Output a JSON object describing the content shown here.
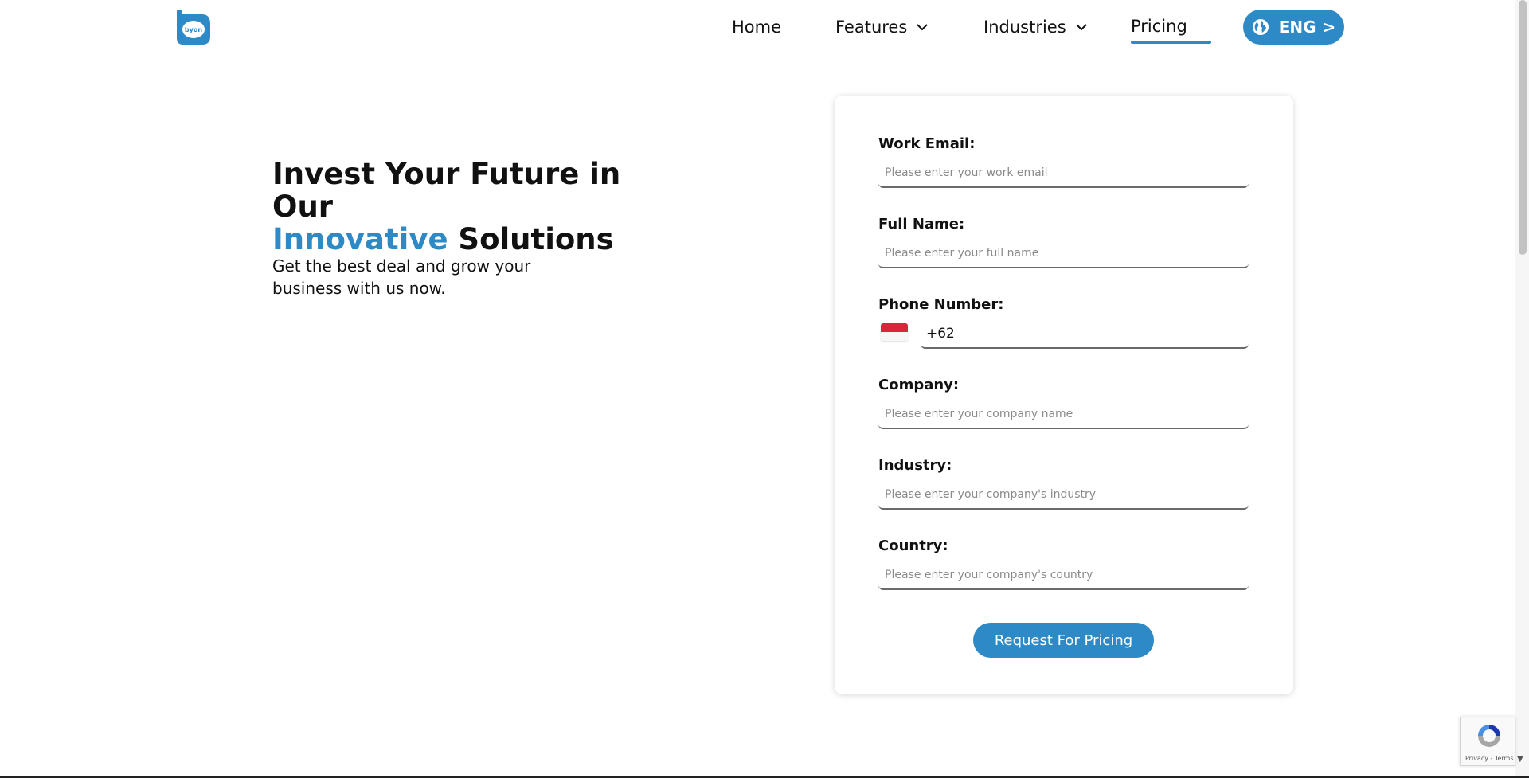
{
  "header": {
    "logo_text": "byon",
    "nav": {
      "home": "Home",
      "features": "Features",
      "industries": "Industries",
      "pricing": "Pricing"
    },
    "lang_label": "ENG",
    "lang_arrow": ">"
  },
  "hero": {
    "title_line1": "Invest Your Future in Our",
    "title_accent": "Innovative",
    "title_rest": " Solutions",
    "subtitle": "Get the best deal and grow your business with us now."
  },
  "form": {
    "email": {
      "label": "Work Email:",
      "placeholder": "Please enter your work email"
    },
    "full_name": {
      "label": "Full Name:",
      "placeholder": "Please enter your full name"
    },
    "phone": {
      "label": "Phone Number:",
      "value": "+62"
    },
    "company": {
      "label": "Company:",
      "placeholder": "Please enter your company name"
    },
    "industry": {
      "label": "Industry:",
      "placeholder": "Please enter your company's industry"
    },
    "country": {
      "label": "Country:",
      "placeholder": "Please enter your company's country"
    },
    "submit_label": "Request For Pricing"
  },
  "recaptcha": {
    "text": "Privacy - Terms"
  },
  "colors": {
    "accent": "#2e8ac6",
    "text": "#111111",
    "flag_red": "#d6263a"
  },
  "icons": [
    "byon-logo",
    "chevron-down-icon",
    "globe-icon",
    "indonesia-flag-icon",
    "recaptcha-icon"
  ]
}
